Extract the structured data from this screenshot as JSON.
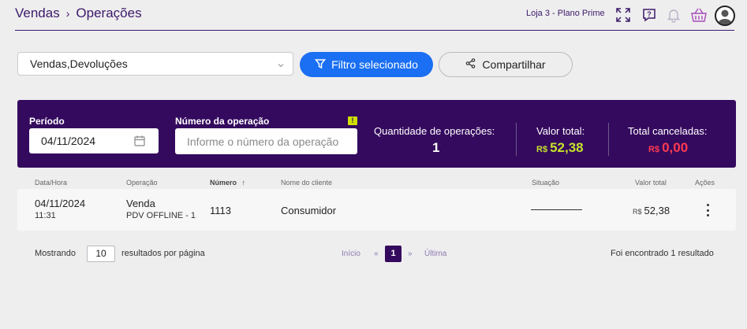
{
  "header": {
    "breadcrumb": [
      "Vendas",
      "Operações"
    ],
    "breadcrumb_sep": "›",
    "store": "Loja 3 - Plano Prime",
    "icons": [
      "expand-icon",
      "help-icon",
      "bell-icon",
      "basket-icon",
      "user-avatar-icon"
    ]
  },
  "filters": {
    "select_value": "Vendas,Devoluções",
    "filter_button": "Filtro selecionado",
    "share_button": "Compartilhar"
  },
  "panel": {
    "period_label": "Período",
    "period_value": "04/11/2024",
    "number_label": "Número da operação",
    "number_placeholder": "Informe o número da operação",
    "warn_glyph": "!",
    "qty_label": "Quantidade de operações:",
    "qty_value": "1",
    "total_label": "Valor total:",
    "total_currency": "R$",
    "total_value": "52,38",
    "canceled_label": "Total canceladas:",
    "canceled_currency": "R$",
    "canceled_value": "0,00",
    "colors": {
      "background": "#340a5e",
      "total": "#c6e22c",
      "canceled": "#ff3b50"
    }
  },
  "table": {
    "headers": {
      "datetime": "Data/Hora",
      "operation": "Operação",
      "number": "Número",
      "sort_glyph": "↑",
      "client": "Nome do cliente",
      "status": "Situação",
      "total": "Valor total",
      "actions": "Ações"
    },
    "rows": [
      {
        "date": "04/11/2024",
        "time": "11:31",
        "operation": "Venda",
        "operation_sub": "PDV OFFLINE - 1",
        "number": "1113",
        "client": "Consumidor",
        "status": "—",
        "currency": "R$",
        "total": "52,38"
      }
    ]
  },
  "footer": {
    "showing_label": "Mostrando",
    "per_page": "10",
    "per_page_suffix": "resultados por página",
    "first": "Início",
    "prev": "«",
    "current_page": "1",
    "next": "»",
    "last": "Última",
    "result_text": "Foi encontrado 1 resultado"
  }
}
